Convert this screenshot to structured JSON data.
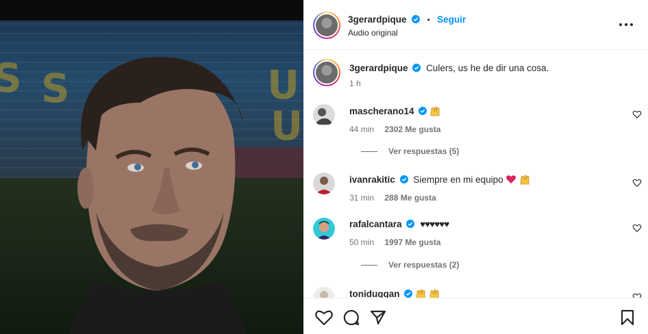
{
  "post": {
    "author": "3gerardpique",
    "follow_label": "Seguir",
    "separator": "•",
    "audio": "Audio original"
  },
  "caption": {
    "author": "3gerardpique",
    "text": "Culers, us he de dir una cosa.",
    "time": "1 h"
  },
  "comments": [
    {
      "user": "mascherano14",
      "text": "",
      "emoji": "raised-hands",
      "time": "44 min",
      "likes": "2302 Me gusta",
      "replies": "Ver respuestas (5)"
    },
    {
      "user": "ivanrakitic",
      "text": "Siempre en mi equipo",
      "emoji": "heart+raised-hands",
      "time": "31 min",
      "likes": "288 Me gusta",
      "replies": ""
    },
    {
      "user": "rafalcantara",
      "text": "♥♥♥♥♥♥",
      "emoji": "",
      "time": "50 min",
      "likes": "1997 Me gusta",
      "replies": "Ver respuestas (2)"
    },
    {
      "user": "toniduggan",
      "text": "",
      "emoji": "raised-hands",
      "time": "",
      "likes": "",
      "replies": ""
    }
  ],
  "icons": {
    "verified": "verified-badge-icon",
    "more": "more-options-icon",
    "like": "heart-icon",
    "comment": "comment-icon",
    "share": "share-icon",
    "save": "bookmark-icon"
  },
  "colors": {
    "accent": "#0095f6",
    "verified": "#0095f6",
    "text": "#262626",
    "muted": "#737373",
    "heart": "#e0245e"
  }
}
